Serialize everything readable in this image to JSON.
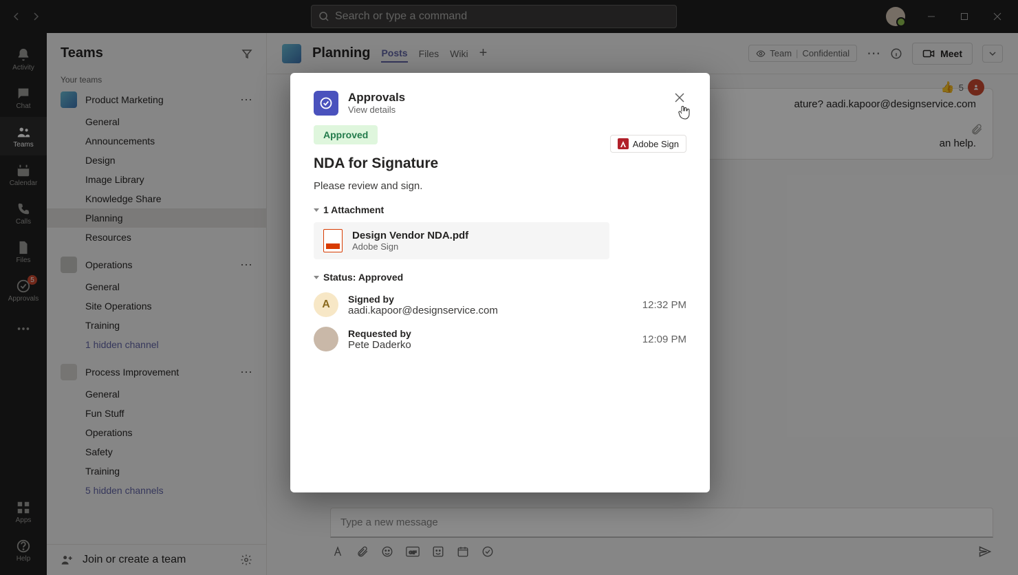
{
  "search": {
    "placeholder": "Search or type a command"
  },
  "rail": {
    "activity": "Activity",
    "chat": "Chat",
    "teams": "Teams",
    "calendar": "Calendar",
    "calls": "Calls",
    "files": "Files",
    "approvals": "Approvals",
    "approvals_badge": "5",
    "apps": "Apps",
    "help": "Help"
  },
  "sidebar": {
    "title": "Teams",
    "your_teams": "Your teams",
    "join": "Join or create a team",
    "teams": [
      {
        "name": "Product Marketing",
        "channels": [
          "General",
          "Announcements",
          "Design",
          "Image Library",
          "Knowledge Share",
          "Planning",
          "Resources"
        ]
      },
      {
        "name": "Operations",
        "channels": [
          "General",
          "Site Operations",
          "Training"
        ],
        "hidden": "1 hidden channel"
      },
      {
        "name": "Process Improvement",
        "channels": [
          "General",
          "Fun Stuff",
          "Operations",
          "Safety",
          "Training"
        ],
        "hidden": "5 hidden channels"
      }
    ]
  },
  "channel_header": {
    "name": "Planning",
    "tabs": [
      "Posts",
      "Files",
      "Wiki"
    ],
    "privacy_team": "Team",
    "privacy_conf": "Confidential",
    "meet": "Meet"
  },
  "message": {
    "line1_tail": "ature? aadi.kapoor@designservice.com",
    "line2_tail": "an help.",
    "react_count": "5"
  },
  "composer": {
    "placeholder": "Type a new message"
  },
  "modal": {
    "app": "Approvals",
    "subtitle": "View details",
    "status": "Approved",
    "provider": "Adobe Sign",
    "title": "NDA for Signature",
    "desc": "Please review and sign.",
    "attach_hdr": "1 Attachment",
    "file": {
      "name": "Design Vendor NDA.pdf",
      "sub": "Adobe Sign"
    },
    "status_hdr": "Status: Approved",
    "timeline": [
      {
        "label": "Signed by",
        "value": "aadi.kapoor@designservice.com",
        "time": "12:32 PM",
        "avatar": "A"
      },
      {
        "label": "Requested by",
        "value": "Pete Daderko",
        "time": "12:09 PM",
        "avatar": "photo"
      }
    ]
  }
}
